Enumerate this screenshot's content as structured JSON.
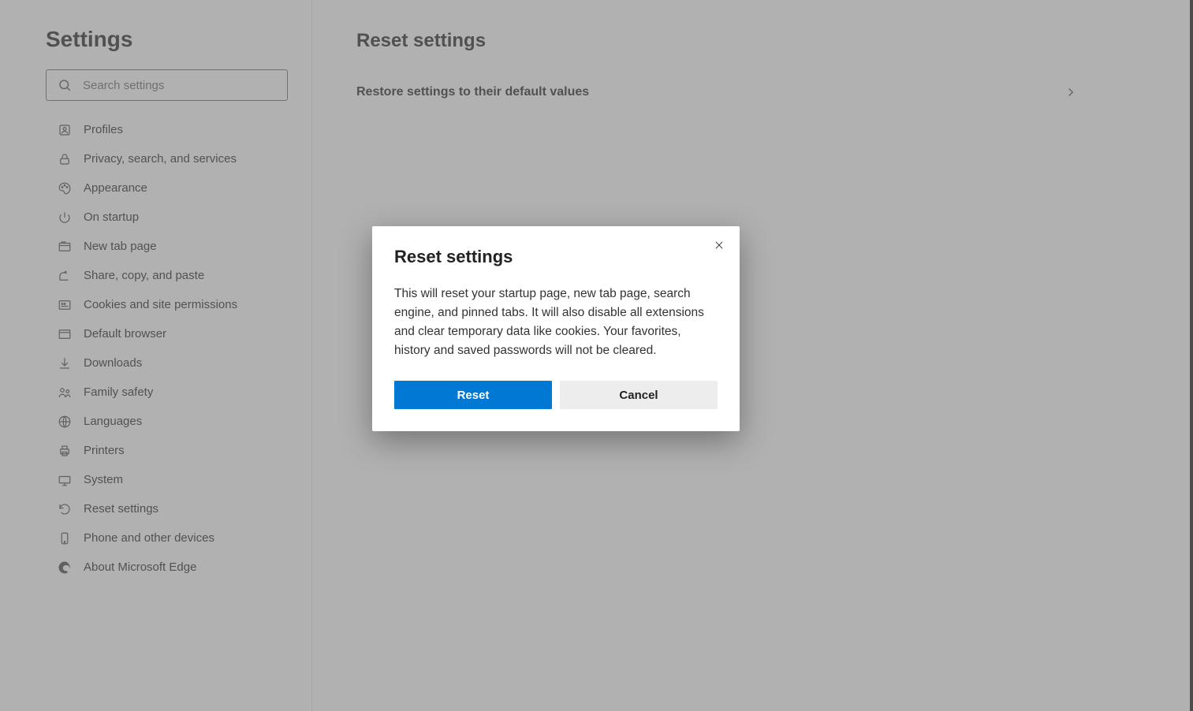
{
  "sidebar": {
    "title": "Settings",
    "search_placeholder": "Search settings",
    "items": [
      {
        "label": "Profiles"
      },
      {
        "label": "Privacy, search, and services"
      },
      {
        "label": "Appearance"
      },
      {
        "label": "On startup"
      },
      {
        "label": "New tab page"
      },
      {
        "label": "Share, copy, and paste"
      },
      {
        "label": "Cookies and site permissions"
      },
      {
        "label": "Default browser"
      },
      {
        "label": "Downloads"
      },
      {
        "label": "Family safety"
      },
      {
        "label": "Languages"
      },
      {
        "label": "Printers"
      },
      {
        "label": "System"
      },
      {
        "label": "Reset settings"
      },
      {
        "label": "Phone and other devices"
      },
      {
        "label": "About Microsoft Edge"
      }
    ]
  },
  "main": {
    "title": "Reset settings",
    "row_label": "Restore settings to their default values"
  },
  "dialog": {
    "title": "Reset settings",
    "body": "This will reset your startup page, new tab page, search engine, and pinned tabs. It will also disable all extensions and clear temporary data like cookies. Your favorites, history and saved passwords will not be cleared.",
    "reset_label": "Reset",
    "cancel_label": "Cancel"
  }
}
